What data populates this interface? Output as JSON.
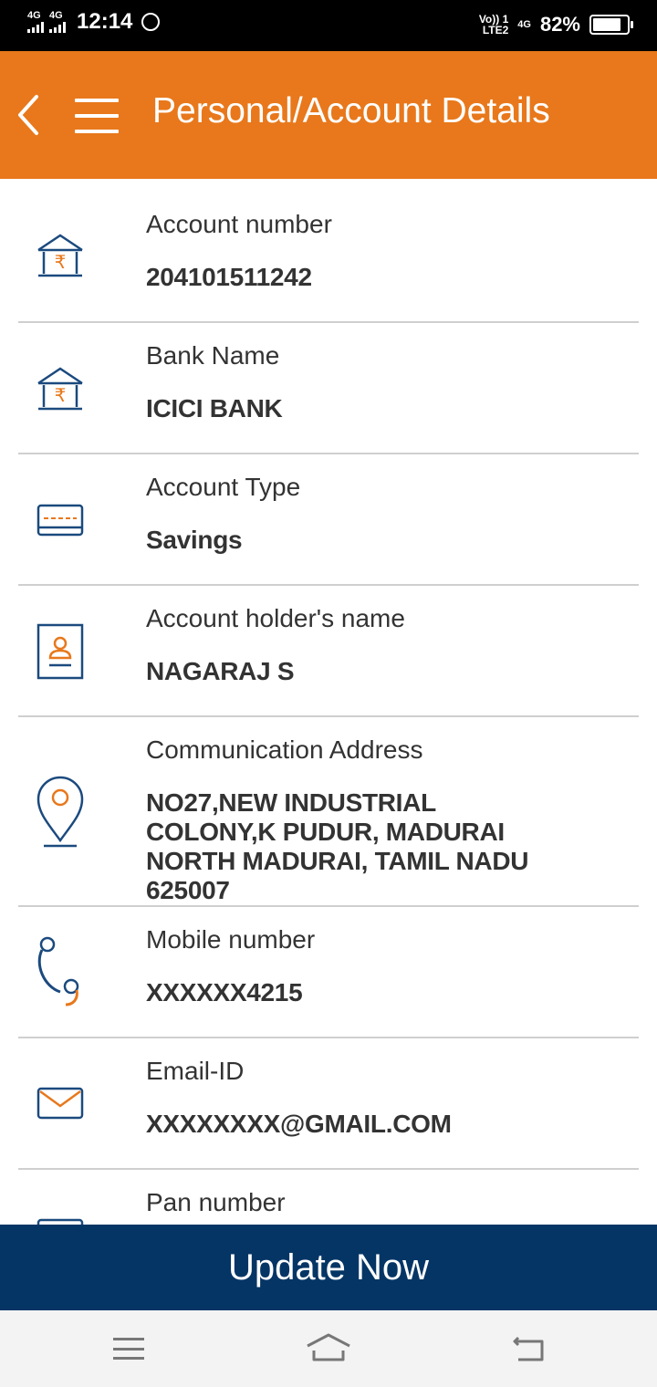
{
  "status_bar": {
    "net1": "4G",
    "net2": "4G",
    "time": "12:14",
    "volte": "Vo)) 1",
    "lte2": "LTE2",
    "net3": "4G",
    "battery": "82%",
    "battery_level": 0.82
  },
  "header": {
    "title": "Personal/Account Details",
    "bg_color": "#e8781b"
  },
  "details": [
    {
      "label": "Account number",
      "value": "204101511242",
      "icon": "bank-icon"
    },
    {
      "label": "Bank Name",
      "value": "ICICI BANK",
      "icon": "bank-icon"
    },
    {
      "label": "Account Type",
      "value": "Savings",
      "icon": "card-icon"
    },
    {
      "label": "Account holder's name",
      "value": "NAGARAJ S",
      "icon": "id-card-icon"
    },
    {
      "label": "Communication Address",
      "value": "NO27,NEW INDUSTRIAL COLONY,K PUDUR, MADURAI NORTH MADURAI, TAMIL NADU 625007",
      "icon": "location-pin-icon"
    },
    {
      "label": "Mobile number",
      "value": "XXXXXX4215",
      "icon": "phone-icon"
    },
    {
      "label": "Email-ID",
      "value": "XXXXXXXX@GMAIL.COM",
      "icon": "mail-icon"
    },
    {
      "label": "Pan number",
      "value": "",
      "icon": "pan-card-icon"
    }
  ],
  "update_button": {
    "label": "Update Now",
    "bg_color": "#053565"
  },
  "colors": {
    "icon_blue": "#1b4a7e",
    "icon_orange": "#e8781b"
  }
}
